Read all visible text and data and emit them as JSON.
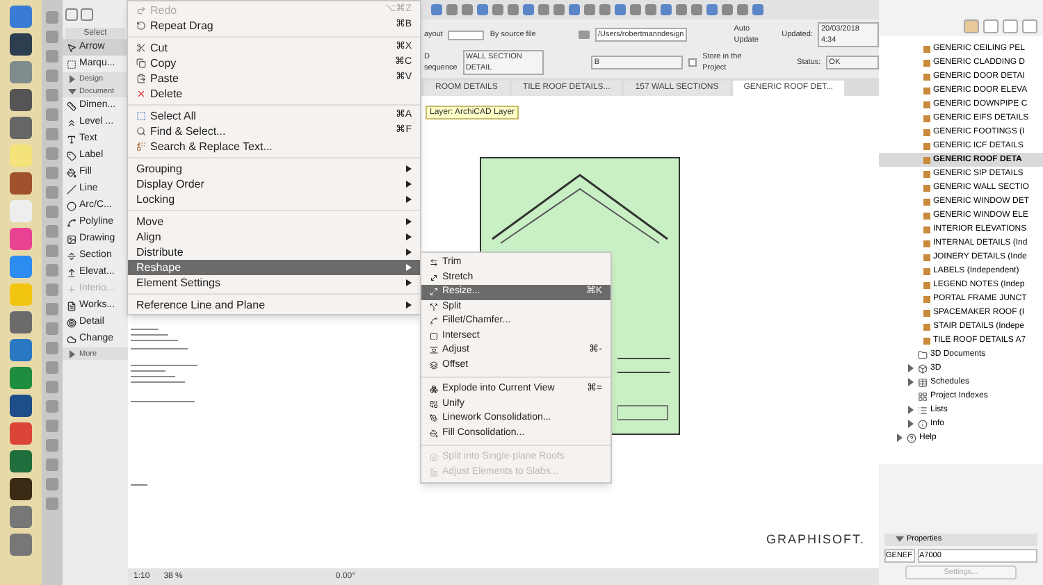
{
  "toolbox": {
    "header": "Select",
    "items": [
      {
        "kind": "tool",
        "label": "Arrow",
        "selected": true,
        "disabled": false
      },
      {
        "kind": "tool",
        "label": "Marqu...",
        "selected": false,
        "disabled": false
      },
      {
        "kind": "group",
        "label": "Design",
        "expanded": false
      },
      {
        "kind": "group",
        "label": "Document",
        "expanded": true
      },
      {
        "kind": "tool",
        "label": "Dimen...",
        "selected": false,
        "disabled": false
      },
      {
        "kind": "tool",
        "label": "Level ...",
        "selected": false,
        "disabled": false
      },
      {
        "kind": "tool",
        "label": "Text",
        "selected": false,
        "disabled": false
      },
      {
        "kind": "tool",
        "label": "Label",
        "selected": false,
        "disabled": false
      },
      {
        "kind": "tool",
        "label": "Fill",
        "selected": false,
        "disabled": false
      },
      {
        "kind": "tool",
        "label": "Line",
        "selected": false,
        "disabled": false
      },
      {
        "kind": "tool",
        "label": "Arc/C...",
        "selected": false,
        "disabled": false
      },
      {
        "kind": "tool",
        "label": "Polyline",
        "selected": false,
        "disabled": false
      },
      {
        "kind": "tool",
        "label": "Drawing",
        "selected": false,
        "disabled": false
      },
      {
        "kind": "tool",
        "label": "Section",
        "selected": false,
        "disabled": false
      },
      {
        "kind": "tool",
        "label": "Elevat...",
        "selected": false,
        "disabled": false
      },
      {
        "kind": "tool",
        "label": "Interio...",
        "selected": false,
        "disabled": true
      },
      {
        "kind": "tool",
        "label": "Works...",
        "selected": false,
        "disabled": false
      },
      {
        "kind": "tool",
        "label": "Detail",
        "selected": false,
        "disabled": false
      },
      {
        "kind": "tool",
        "label": "Change",
        "selected": false,
        "disabled": false
      },
      {
        "kind": "group",
        "label": "More",
        "expanded": false
      }
    ]
  },
  "info_bar": {
    "layout_label": "ayout",
    "source_label": "By source file",
    "path": "/Users/robertmanndesign",
    "auto_update_label": "Auto Update",
    "updated_label": "Updated:",
    "updated_value": "20/03/2018 4:34",
    "id_label": "D sequence",
    "id_value": "WALL SECTION DETAIL",
    "id_field": "B",
    "store_label": "Store in the Project",
    "store_checked": false,
    "status_label": "Status:",
    "status_value": "OK"
  },
  "tabs": [
    {
      "label": "ROOM DETAILS",
      "selected": false
    },
    {
      "label": "TILE ROOF DETAILS...",
      "selected": false
    },
    {
      "label": "157 WALL SECTIONS",
      "selected": false
    },
    {
      "label": "GENERIC ROOF DET...",
      "selected": true
    }
  ],
  "edit_menu": [
    {
      "kind": "item",
      "label": "Redo",
      "shortcut": "⌥⌘Z",
      "submenu": false,
      "disabled": true,
      "selected": false
    },
    {
      "kind": "item",
      "label": "Repeat Drag",
      "shortcut": "⌘B",
      "submenu": false,
      "disabled": false,
      "selected": false
    },
    {
      "kind": "separator"
    },
    {
      "kind": "item",
      "label": "Cut",
      "shortcut": "⌘X",
      "submenu": false,
      "disabled": false,
      "selected": false
    },
    {
      "kind": "item",
      "label": "Copy",
      "shortcut": "⌘C",
      "submenu": false,
      "disabled": false,
      "selected": false
    },
    {
      "kind": "item",
      "label": "Paste",
      "shortcut": "⌘V",
      "submenu": false,
      "disabled": false,
      "selected": false
    },
    {
      "kind": "item",
      "label": "Delete",
      "submenu": false,
      "disabled": false,
      "selected": false
    },
    {
      "kind": "separator"
    },
    {
      "kind": "item",
      "label": "Select All",
      "shortcut": "⌘A",
      "submenu": false,
      "disabled": false,
      "selected": false
    },
    {
      "kind": "item",
      "label": "Find & Select...",
      "shortcut": "⌘F",
      "submenu": false,
      "disabled": false,
      "selected": false
    },
    {
      "kind": "item",
      "label": "Search & Replace Text...",
      "submenu": false,
      "disabled": false,
      "selected": false
    },
    {
      "kind": "separator"
    },
    {
      "kind": "item",
      "label": "Grouping",
      "submenu": true,
      "disabled": false,
      "selected": false
    },
    {
      "kind": "item",
      "label": "Display Order",
      "submenu": true,
      "disabled": false,
      "selected": false
    },
    {
      "kind": "item",
      "label": "Locking",
      "submenu": true,
      "disabled": false,
      "selected": false
    },
    {
      "kind": "separator"
    },
    {
      "kind": "item",
      "label": "Move",
      "submenu": true,
      "disabled": false,
      "selected": false
    },
    {
      "kind": "item",
      "label": "Align",
      "submenu": true,
      "disabled": false,
      "selected": false
    },
    {
      "kind": "item",
      "label": "Distribute",
      "submenu": true,
      "disabled": false,
      "selected": false
    },
    {
      "kind": "item",
      "label": "Reshape",
      "submenu": true,
      "disabled": false,
      "selected": true
    },
    {
      "kind": "item",
      "label": "Element Settings",
      "submenu": true,
      "disabled": false,
      "selected": false
    },
    {
      "kind": "separator"
    },
    {
      "kind": "item",
      "label": "Reference Line and Plane",
      "submenu": true,
      "disabled": false,
      "selected": false
    }
  ],
  "tooltip": "Layer: ArchiCAD Layer",
  "reshape_menu": [
    {
      "kind": "item",
      "label": "Trim",
      "disabled": false,
      "selected": false
    },
    {
      "kind": "item",
      "label": "Stretch",
      "disabled": false,
      "selected": false
    },
    {
      "kind": "item",
      "label": "Resize...",
      "shortcut": "⌘K",
      "disabled": false,
      "selected": true
    },
    {
      "kind": "item",
      "label": "Split",
      "disabled": false,
      "selected": false
    },
    {
      "kind": "item",
      "label": "Fillet/Chamfer...",
      "disabled": false,
      "selected": false
    },
    {
      "kind": "item",
      "label": "Intersect",
      "disabled": false,
      "selected": false
    },
    {
      "kind": "item",
      "label": "Adjust",
      "shortcut": "⌘-",
      "disabled": false,
      "selected": false
    },
    {
      "kind": "item",
      "label": "Offset",
      "disabled": false,
      "selected": false
    },
    {
      "kind": "separator"
    },
    {
      "kind": "item",
      "label": "Explode into Current View",
      "shortcut": "⌘=",
      "disabled": false,
      "selected": false
    },
    {
      "kind": "item",
      "label": "Unify",
      "disabled": false,
      "selected": false
    },
    {
      "kind": "item",
      "label": "Linework Consolidation...",
      "disabled": false,
      "selected": false
    },
    {
      "kind": "item",
      "label": "Fill Consolidation...",
      "disabled": false,
      "selected": false
    },
    {
      "kind": "separator"
    },
    {
      "kind": "item",
      "label": "Split into Single-plane Roofs",
      "disabled": true,
      "selected": false
    },
    {
      "kind": "item",
      "label": "Adjust Elements to Slabs...",
      "disabled": true,
      "selected": false
    }
  ],
  "navigator": {
    "views": [
      {
        "label": "GENERIC CEILING PEL",
        "selected": false
      },
      {
        "label": "GENERIC CLADDING D",
        "selected": false
      },
      {
        "label": "GENERIC DOOR DETAI",
        "selected": false
      },
      {
        "label": "GENERIC DOOR ELEVA",
        "selected": false
      },
      {
        "label": "GENERIC DOWNPIPE C",
        "selected": false
      },
      {
        "label": "GENERIC EIFS DETAILS",
        "selected": false
      },
      {
        "label": "GENERIC FOOTINGS (I",
        "selected": false
      },
      {
        "label": "GENERIC ICF DETAILS",
        "selected": false
      },
      {
        "label": "GENERIC ROOF DETA",
        "selected": true
      },
      {
        "label": "GENERIC SIP DETAILS",
        "selected": false
      },
      {
        "label": "GENERIC WALL SECTIO",
        "selected": false
      },
      {
        "label": "GENERIC WINDOW DET",
        "selected": false
      },
      {
        "label": "GENERIC WINDOW ELE",
        "selected": false
      },
      {
        "label": "INTERIOR ELEVATIONS",
        "selected": false
      },
      {
        "label": "INTERNAL DETAILS (Ind",
        "selected": false
      },
      {
        "label": "JOINERY DETAILS (Inde",
        "selected": false
      },
      {
        "label": "LABELS (Independent)",
        "selected": false
      },
      {
        "label": "LEGEND NOTES (Indep",
        "selected": false
      },
      {
        "label": "PORTAL FRAME JUNCT",
        "selected": false
      },
      {
        "label": "SPACEMAKER ROOF (I",
        "selected": false
      },
      {
        "label": "STAIR DETAILS (Indepe",
        "selected": false
      },
      {
        "label": "TILE ROOF DETAILS A7",
        "selected": false
      }
    ],
    "folders": [
      {
        "label": "3D Documents",
        "expandable": false
      },
      {
        "label": "3D",
        "expandable": true
      },
      {
        "label": "Schedules",
        "expandable": true
      },
      {
        "label": "Project Indexes",
        "expandable": false
      },
      {
        "label": "Lists",
        "expandable": true
      },
      {
        "label": "Info",
        "expandable": true
      }
    ],
    "root": [
      {
        "label": "Help",
        "expandable": true
      }
    ],
    "properties": {
      "header": "Properties",
      "id": "GENEF",
      "name": "A7000",
      "button": "Settings..."
    }
  },
  "logo": "GRAPHISOFT.",
  "status_bar": {
    "scale": "1:10",
    "zoom": "38 %",
    "angle": "0.00°"
  }
}
